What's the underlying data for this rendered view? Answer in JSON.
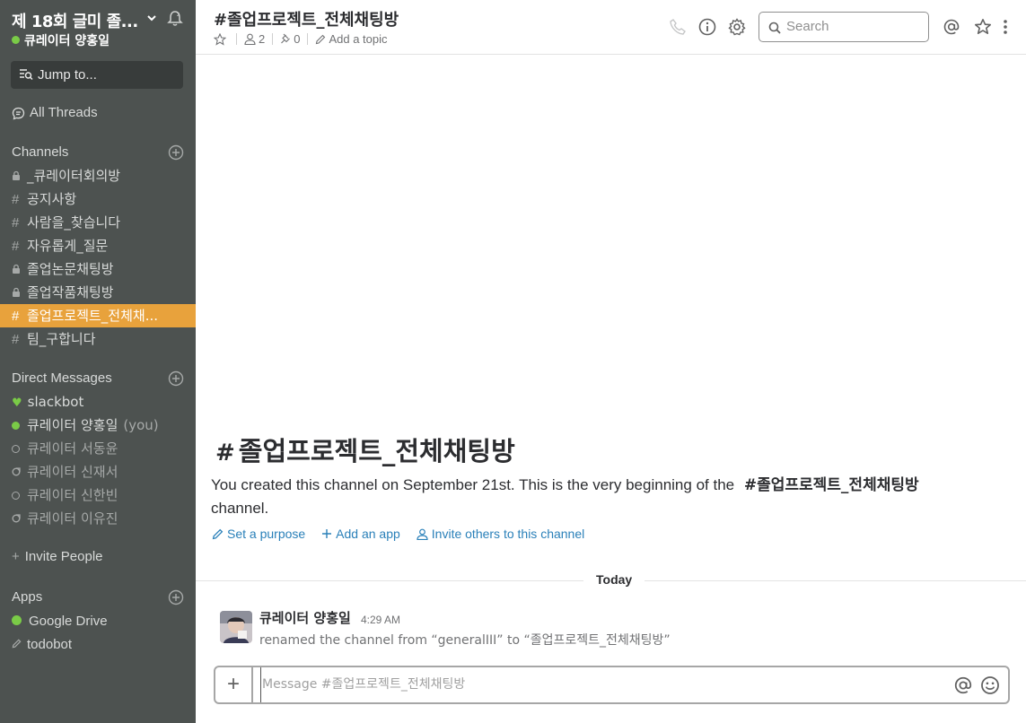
{
  "workspace": {
    "name": "제 18회 글미 졸...",
    "user": "큐레이터 양홍일"
  },
  "sidebar": {
    "jump_label": "Jump to...",
    "all_threads": "All Threads",
    "channels_title": "Channels",
    "channels": [
      {
        "prefix": "lock",
        "name": "_큐레이터회의방"
      },
      {
        "prefix": "#",
        "name": "공지사항"
      },
      {
        "prefix": "#",
        "name": "사람을_찾습니다"
      },
      {
        "prefix": "#",
        "name": "자유롭게_질문"
      },
      {
        "prefix": "lock",
        "name": "졸업논문채팅방"
      },
      {
        "prefix": "lock",
        "name": "졸업작품채팅방"
      },
      {
        "prefix": "#",
        "name": "졸업프로젝트_전체채...",
        "active": true
      },
      {
        "prefix": "#",
        "name": "팀_구합니다"
      }
    ],
    "dm_title": "Direct Messages",
    "dms": [
      {
        "status": "heart",
        "name": "slackbot"
      },
      {
        "status": "online",
        "name": "큐레이터 양홍일",
        "you": "(you)"
      },
      {
        "status": "offline",
        "name": "큐레이터 서동윤"
      },
      {
        "status": "away",
        "name": "큐레이터 신재서"
      },
      {
        "status": "offline",
        "name": "큐레이터 신한빈"
      },
      {
        "status": "away",
        "name": "큐레이터 이유진"
      }
    ],
    "invite_label": "Invite People",
    "apps_title": "Apps",
    "apps": [
      {
        "status": "online",
        "name": "Google Drive"
      },
      {
        "status": "pencil",
        "name": "todobot"
      }
    ]
  },
  "header": {
    "channel": "#졸업프로젝트_전체채팅방",
    "members": "2",
    "pins": "0",
    "topic_label": "Add a topic",
    "search_placeholder": "Search"
  },
  "intro": {
    "title": "졸업프로젝트_전체채팅방",
    "text_before": "You created this channel on September 21st. This is the very beginning of the",
    "channel_name": "졸업프로젝트_전체채팅방",
    "text_after": "channel.",
    "actions": {
      "purpose": "Set a purpose",
      "add_app": "Add an app",
      "invite": "Invite others to this channel"
    }
  },
  "divider": "Today",
  "messages": [
    {
      "author": "큐레이터 양홍일",
      "time": "4:29 AM",
      "text": "renamed the channel from “generalIII” to “졸업프로젝트_전체채팅방”"
    }
  ],
  "composer": {
    "placeholder": "Message #졸업프로젝트_전체채팅방"
  },
  "colors": {
    "sidebar_bg": "#4d5250",
    "active_channel": "#e8a23c",
    "presence": "#7acb47",
    "link": "#2a80b9"
  }
}
